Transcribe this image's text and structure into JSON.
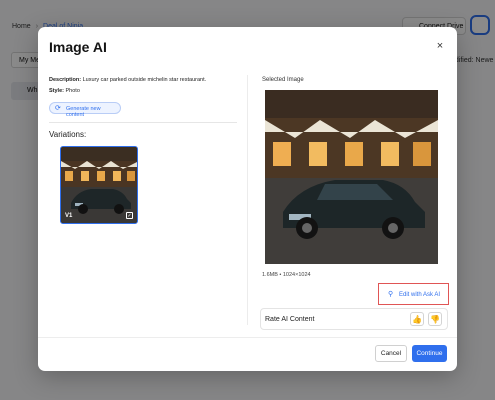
{
  "background": {
    "breadcrumb": [
      "Home",
      "Deal of Ninja"
    ],
    "connect_label": "Connect Drive",
    "tab_label": "My Me",
    "modified_label": "odified: Newe",
    "folder_label": "Wh"
  },
  "modal": {
    "title": "Image AI",
    "close_glyph": "×",
    "description_label": "Description:",
    "description_value": "Luxury car parked outside michelin star restaurant.",
    "style_label": "Style:",
    "style_value": "Photo",
    "generate_label": "Generate new content",
    "variations_title": "Variations:",
    "variations": [
      {
        "label": "V1",
        "selected": true
      }
    ],
    "selected_title": "Selected Image",
    "selected_info": "1.6MB • 1024×1024",
    "edit_label": "Edit with Ask AI",
    "rate_label": "Rate AI Content",
    "cancel_label": "Cancel",
    "continue_label": "Continue"
  },
  "icons": {
    "generate": "refresh-icon",
    "edit": "magic-wand-icon",
    "thumbs_up": "thumbs-up-icon",
    "thumbs_down": "thumbs-down-icon",
    "close": "close-icon",
    "check": "check-icon"
  },
  "colors": {
    "accent": "#2f6fed",
    "highlight_border": "#e05555"
  }
}
